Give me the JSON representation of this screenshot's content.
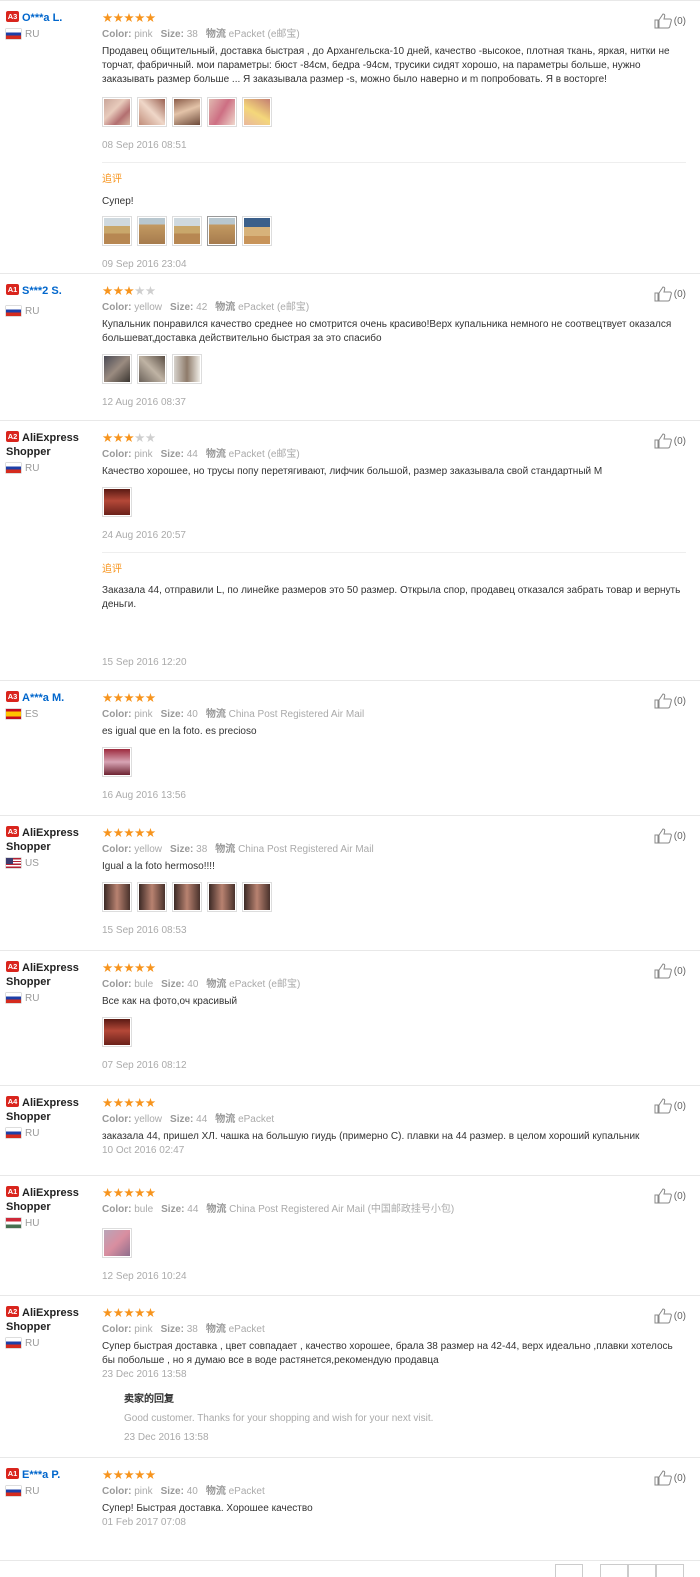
{
  "reviews": [
    {
      "level": "A3",
      "name": "O***a L.",
      "country": "RU",
      "stars": 5,
      "color_label": "Color:",
      "color": "pink",
      "size_label": "Size:",
      "size": "38",
      "ship_label": "物流",
      "ship": "ePacket (e邮宝)",
      "text": "Продавец общительный, доставка быстрая , до Архангельска-10 дней, качество -высокое, плотная ткань, яркая, нитки не торчат, фабричный. мои параметры: бюст -84см, бедра -94см, трусики сидят хорошо, на параметры больше, нужно заказывать размер больше ... Я заказывала размер -s, можно было наверно и m попробовать. Я в восторге!",
      "date": "08 Sep 2016 08:51",
      "likes": "(0)",
      "additional_label": "追评",
      "additional_text": "Супер!",
      "additional_date": "09 Sep 2016 23:04"
    },
    {
      "level": "A1",
      "name": "S***2 S.",
      "country": "RU",
      "stars": 3,
      "color_label": "Color:",
      "color": "yellow",
      "size_label": "Size:",
      "size": "42",
      "ship_label": "物流",
      "ship": "ePacket (e邮宝)",
      "text": "Купальник понравился качество среднее но смотрится очень красиво!Верх купальника немного не соотвецтвует оказался большеват,доставка действительно быстрая за это спасибо",
      "date": "12 Aug 2016 08:37",
      "likes": "(0)"
    },
    {
      "level": "A2",
      "name": "AliExpress Shopper",
      "country": "RU",
      "stars": 3,
      "color_label": "Color:",
      "color": "pink",
      "size_label": "Size:",
      "size": "44",
      "ship_label": "物流",
      "ship": "ePacket (e邮宝)",
      "text": "Качество хорошее, но трусы попу перетягивают, лифчик большой, размер заказывала свой стандартный M",
      "date": "24 Aug 2016 20:57",
      "likes": "(0)",
      "additional_label": "追评",
      "additional_text": "Заказала 44, отправили L, по линейке размеров это 50 размер. Открыла спор, продавец отказался забрать товар и вернуть деньги.",
      "additional_date": "15 Sep 2016 12:20"
    },
    {
      "level": "A3",
      "name": "A***a M.",
      "country": "ES",
      "stars": 5,
      "color_label": "Color:",
      "color": "pink",
      "size_label": "Size:",
      "size": "40",
      "ship_label": "物流",
      "ship": "China Post Registered Air Mail",
      "text": "es igual que en la foto. es precioso",
      "date": "16 Aug 2016 13:56",
      "likes": "(0)"
    },
    {
      "level": "A3",
      "name": "AliExpress Shopper",
      "country": "US",
      "stars": 5,
      "color_label": "Color:",
      "color": "yellow",
      "size_label": "Size:",
      "size": "38",
      "ship_label": "物流",
      "ship": "China Post Registered Air Mail",
      "text": "Igual a la foto hermoso!!!!",
      "date": "15 Sep 2016 08:53",
      "likes": "(0)"
    },
    {
      "level": "A2",
      "name": "AliExpress Shopper",
      "country": "RU",
      "stars": 5,
      "color_label": "Color:",
      "color": "bule",
      "size_label": "Size:",
      "size": "40",
      "ship_label": "物流",
      "ship": "ePacket (e邮宝)",
      "text": "Все как на фото,оч красивый",
      "date": "07 Sep 2016 08:12",
      "likes": "(0)"
    },
    {
      "level": "A4",
      "name": "AliExpress Shopper",
      "country": "RU",
      "stars": 5,
      "color_label": "Color:",
      "color": "yellow",
      "size_label": "Size:",
      "size": "44",
      "ship_label": "物流",
      "ship": "ePacket",
      "text": "заказала 44, пришел XЛ. чашка на большую гиудь (примерно С). плавки на 44 размер. в целом хороший купальник",
      "date": "10 Oct 2016 02:47",
      "likes": "(0)"
    },
    {
      "level": "A1",
      "name": "AliExpress Shopper",
      "country": "HU",
      "stars": 5,
      "color_label": "Color:",
      "color": "bule",
      "size_label": "Size:",
      "size": "44",
      "ship_label": "物流",
      "ship": "China Post Registered Air Mail (中国邮政挂号小包)",
      "text": "",
      "date": "12 Sep 2016 10:24",
      "likes": "(0)"
    },
    {
      "level": "A2",
      "name": "AliExpress Shopper",
      "country": "RU",
      "stars": 5,
      "color_label": "Color:",
      "color": "pink",
      "size_label": "Size:",
      "size": "38",
      "ship_label": "物流",
      "ship": "ePacket",
      "text": "Супер быстрая доставка , цвет совпадает , качество хорошее, брала 38 размер на 42-44, верх идеально ,плавки хотелось бы побольше , но я думаю все в воде растянется,рекомендую продавца",
      "date": "23 Dec 2016 13:58",
      "likes": "(0)",
      "reply_title": "卖家的回复",
      "reply_text": "Good customer. Thanks for your shopping and wish for your next visit.",
      "reply_date": "23 Dec 2016 13:58"
    },
    {
      "level": "A1",
      "name": "E***a P.",
      "country": "RU",
      "stars": 5,
      "color_label": "Color:",
      "color": "pink",
      "size_label": "Size:",
      "size": "40",
      "ship_label": "物流",
      "ship": "ePacket",
      "text": "Супер! Быстрая доставка. Хорошее качество",
      "date": "01 Feb 2017 07:08",
      "likes": "(0)"
    }
  ],
  "icons": {
    "like": "thumbs-up-icon",
    "star": "star-icon",
    "flag": "country-flag-icon"
  },
  "colors": {
    "star": "#f7941d",
    "level_badge": "#d9251d",
    "username": "#0066cc",
    "additional_label": "#f7941d"
  }
}
